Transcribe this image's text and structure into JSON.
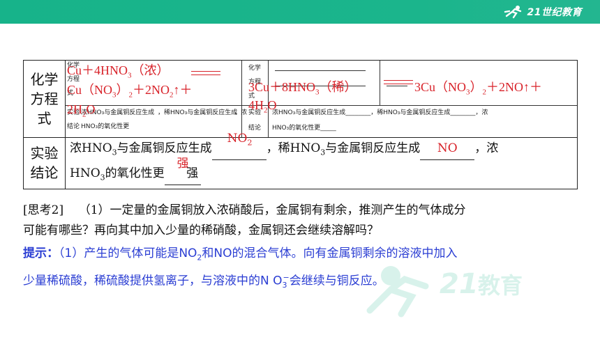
{
  "brand": {
    "logo_text": "21世纪教育"
  },
  "table": {
    "row1_header": "化学方程式",
    "row2_header": "实验结论",
    "left_tiny": {
      "label1": "化学",
      "label2": "方程",
      "label3": "式",
      "label4": "实验",
      "label5": "结论",
      "conclusion_a": "浓HNO₃与金属铜反应生成",
      "conclusion_b": "，稀HNO₃与金属铜反应生成",
      "conclusion_c": "，浓",
      "conclusion_d": "HNO₃的氧化性更"
    },
    "right_tiny": {
      "label1": "化学",
      "label2": "方程",
      "label3": "式",
      "label4": "实验",
      "label5": "结论",
      "conclusion_a": "浓HNO₃与金属铜反应生成________，稀HNO₃与金属铜反应生成________，浓",
      "conclusion_d": "HNO₃的氧化性更_____"
    },
    "eq1_line1": "Cu＋4HNO",
    "eq1_line1_sub": "3",
    "eq1_line1_tail": "（浓）",
    "eq1_line2a": "Cu（NO",
    "eq1_line2_sub1": "3",
    "eq1_line2b": "）",
    "eq1_line2_sub2": "2",
    "eq1_line2c": "＋2NO",
    "eq1_line2_sub3": "2",
    "eq1_line2d": "↑＋",
    "eq1_line3a": "2H",
    "eq1_line3_sub": "2",
    "eq1_line3b": "O",
    "eq2_line1": "3Cu＋8HNO",
    "eq2_line1_sub": "3",
    "eq2_line1_tail": "（稀）",
    "eq2_product": "3Cu（NO",
    "eq2_product_sub1": "3",
    "eq2_product_b": "）",
    "eq2_product_sub2": "2",
    "eq2_product_c": "＋2NO↑＋",
    "eq2_line2a": "4H",
    "eq2_line2_sub": "2",
    "eq2_line2b": "O",
    "concl_text_a": "浓HNO",
    "concl_text_a_sub": "3",
    "concl_text_a2": "与金属铜反应生成",
    "concl_ans1": "NO",
    "concl_ans1_sub": "2",
    "concl_text_b": "，稀HNO",
    "concl_text_b_sub": "3",
    "concl_text_b2": "与金属铜反应生成",
    "concl_ans2": "NO",
    "concl_text_c": "，浓",
    "concl_text_d": "HNO",
    "concl_text_d_sub": "3",
    "concl_text_d2": "的氧化性更",
    "concl_ans3": "强",
    "concl_text_e": "强"
  },
  "think": {
    "label": "[思考2]",
    "text1": "（1）一定量的金属铜放入浓硝酸后，金属铜有剩余，推测产生的气体成分",
    "text2": "可能有哪些？再向其中加入少量的稀硝酸，金属铜还会继续溶解吗？"
  },
  "hint": {
    "label": "提示：",
    "text1a": "（1）产生的气体可能是NO",
    "text1_sub": "2",
    "text1b": "和NO的混合气体。向有金属铜剩余的溶液中加入",
    "text2a": "少量稀硫酸，稀硫酸提供氢离子，与溶液中的N O",
    "text2_sub": "3",
    "text2_sup": "−",
    "text2b": "会继续与铜反应。"
  },
  "colors": {
    "green": "#17b38a",
    "red": "#d8232a",
    "blue": "#2b3ed3"
  }
}
